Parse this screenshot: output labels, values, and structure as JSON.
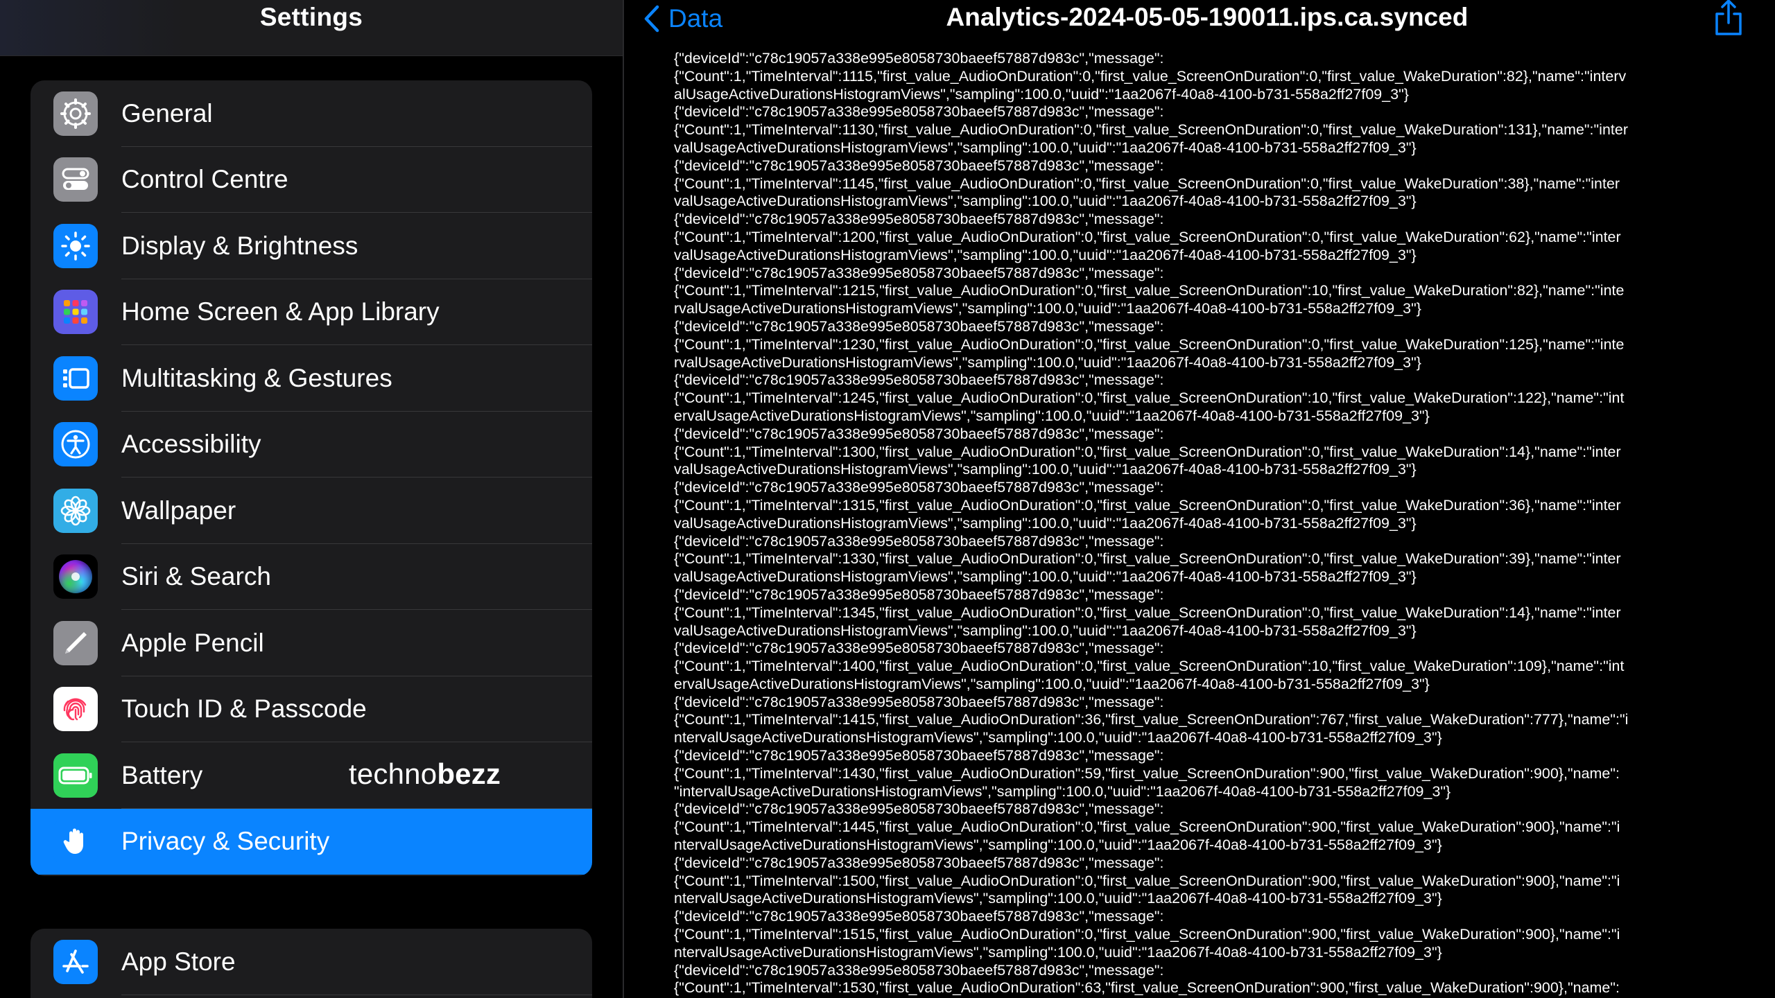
{
  "sidebar": {
    "title": "Settings",
    "items": [
      {
        "label": "General",
        "icon": "gear-icon",
        "color": "#8e8e93"
      },
      {
        "label": "Control Centre",
        "icon": "toggles-icon",
        "color": "#8e8e93"
      },
      {
        "label": "Display & Brightness",
        "icon": "sun-icon",
        "color": "#0a84ff"
      },
      {
        "label": "Home Screen & App Library",
        "icon": "app-grid-icon",
        "color": "#5e5ce6"
      },
      {
        "label": "Multitasking & Gestures",
        "icon": "multitasking-icon",
        "color": "#0a84ff"
      },
      {
        "label": "Accessibility",
        "icon": "accessibility-icon",
        "color": "#0a84ff"
      },
      {
        "label": "Wallpaper",
        "icon": "flower-icon",
        "color": "#32ade6"
      },
      {
        "label": "Siri & Search",
        "icon": "siri-icon",
        "color": "#000000"
      },
      {
        "label": "Apple Pencil",
        "icon": "pencil-icon",
        "color": "#8e8e93"
      },
      {
        "label": "Touch ID & Passcode",
        "icon": "fingerprint-icon",
        "color": "#ffffff"
      },
      {
        "label": "Battery",
        "icon": "battery-icon",
        "color": "#30d158"
      },
      {
        "label": "Privacy & Security",
        "icon": "hand-icon",
        "color": "#0a84ff",
        "selected": true
      }
    ],
    "items2": [
      {
        "label": "App Store",
        "icon": "app-store-icon",
        "color": "#0a84ff"
      }
    ]
  },
  "watermark": {
    "part1": "techno",
    "part2": "bezz"
  },
  "detail": {
    "back_label": "Data",
    "title": "Analytics-2024-05-05-190011.ips.ca.synced",
    "log_lines": [
      "{\"deviceId\":\"c78c19057a338e995e8058730baeef57887d983c\",\"message\":",
      "{\"Count\":1,\"TimeInterval\":1115,\"first_value_AudioOnDuration\":0,\"first_value_ScreenOnDuration\":0,\"first_value_WakeDuration\":82},\"name\":\"interv",
      "alUsageActiveDurationsHistogramViews\",\"sampling\":100.0,\"uuid\":\"1aa2067f-40a8-4100-b731-558a2ff27f09_3\"}",
      "{\"deviceId\":\"c78c19057a338e995e8058730baeef57887d983c\",\"message\":",
      "{\"Count\":1,\"TimeInterval\":1130,\"first_value_AudioOnDuration\":0,\"first_value_ScreenOnDuration\":0,\"first_value_WakeDuration\":131},\"name\":\"inter",
      "valUsageActiveDurationsHistogramViews\",\"sampling\":100.0,\"uuid\":\"1aa2067f-40a8-4100-b731-558a2ff27f09_3\"}",
      "{\"deviceId\":\"c78c19057a338e995e8058730baeef57887d983c\",\"message\":",
      "{\"Count\":1,\"TimeInterval\":1145,\"first_value_AudioOnDuration\":0,\"first_value_ScreenOnDuration\":0,\"first_value_WakeDuration\":38},\"name\":\"inter",
      "valUsageActiveDurationsHistogramViews\",\"sampling\":100.0,\"uuid\":\"1aa2067f-40a8-4100-b731-558a2ff27f09_3\"}",
      "{\"deviceId\":\"c78c19057a338e995e8058730baeef57887d983c\",\"message\":",
      "{\"Count\":1,\"TimeInterval\":1200,\"first_value_AudioOnDuration\":0,\"first_value_ScreenOnDuration\":0,\"first_value_WakeDuration\":62},\"name\":\"inter",
      "valUsageActiveDurationsHistogramViews\",\"sampling\":100.0,\"uuid\":\"1aa2067f-40a8-4100-b731-558a2ff27f09_3\"}",
      "{\"deviceId\":\"c78c19057a338e995e8058730baeef57887d983c\",\"message\":",
      "{\"Count\":1,\"TimeInterval\":1215,\"first_value_AudioOnDuration\":0,\"first_value_ScreenOnDuration\":10,\"first_value_WakeDuration\":82},\"name\":\"inte",
      "rvalUsageActiveDurationsHistogramViews\",\"sampling\":100.0,\"uuid\":\"1aa2067f-40a8-4100-b731-558a2ff27f09_3\"}",
      "{\"deviceId\":\"c78c19057a338e995e8058730baeef57887d983c\",\"message\":",
      "{\"Count\":1,\"TimeInterval\":1230,\"first_value_AudioOnDuration\":0,\"first_value_ScreenOnDuration\":0,\"first_value_WakeDuration\":125},\"name\":\"inte",
      "rvalUsageActiveDurationsHistogramViews\",\"sampling\":100.0,\"uuid\":\"1aa2067f-40a8-4100-b731-558a2ff27f09_3\"}",
      "{\"deviceId\":\"c78c19057a338e995e8058730baeef57887d983c\",\"message\":",
      "{\"Count\":1,\"TimeInterval\":1245,\"first_value_AudioOnDuration\":0,\"first_value_ScreenOnDuration\":10,\"first_value_WakeDuration\":122},\"name\":\"int",
      "ervalUsageActiveDurationsHistogramViews\",\"sampling\":100.0,\"uuid\":\"1aa2067f-40a8-4100-b731-558a2ff27f09_3\"}",
      "{\"deviceId\":\"c78c19057a338e995e8058730baeef57887d983c\",\"message\":",
      "{\"Count\":1,\"TimeInterval\":1300,\"first_value_AudioOnDuration\":0,\"first_value_ScreenOnDuration\":0,\"first_value_WakeDuration\":14},\"name\":\"inter",
      "valUsageActiveDurationsHistogramViews\",\"sampling\":100.0,\"uuid\":\"1aa2067f-40a8-4100-b731-558a2ff27f09_3\"}",
      "{\"deviceId\":\"c78c19057a338e995e8058730baeef57887d983c\",\"message\":",
      "{\"Count\":1,\"TimeInterval\":1315,\"first_value_AudioOnDuration\":0,\"first_value_ScreenOnDuration\":0,\"first_value_WakeDuration\":36},\"name\":\"inter",
      "valUsageActiveDurationsHistogramViews\",\"sampling\":100.0,\"uuid\":\"1aa2067f-40a8-4100-b731-558a2ff27f09_3\"}",
      "{\"deviceId\":\"c78c19057a338e995e8058730baeef57887d983c\",\"message\":",
      "{\"Count\":1,\"TimeInterval\":1330,\"first_value_AudioOnDuration\":0,\"first_value_ScreenOnDuration\":0,\"first_value_WakeDuration\":39},\"name\":\"inter",
      "valUsageActiveDurationsHistogramViews\",\"sampling\":100.0,\"uuid\":\"1aa2067f-40a8-4100-b731-558a2ff27f09_3\"}",
      "{\"deviceId\":\"c78c19057a338e995e8058730baeef57887d983c\",\"message\":",
      "{\"Count\":1,\"TimeInterval\":1345,\"first_value_AudioOnDuration\":0,\"first_value_ScreenOnDuration\":0,\"first_value_WakeDuration\":14},\"name\":\"inter",
      "valUsageActiveDurationsHistogramViews\",\"sampling\":100.0,\"uuid\":\"1aa2067f-40a8-4100-b731-558a2ff27f09_3\"}",
      "{\"deviceId\":\"c78c19057a338e995e8058730baeef57887d983c\",\"message\":",
      "{\"Count\":1,\"TimeInterval\":1400,\"first_value_AudioOnDuration\":0,\"first_value_ScreenOnDuration\":10,\"first_value_WakeDuration\":109},\"name\":\"int",
      "ervalUsageActiveDurationsHistogramViews\",\"sampling\":100.0,\"uuid\":\"1aa2067f-40a8-4100-b731-558a2ff27f09_3\"}",
      "{\"deviceId\":\"c78c19057a338e995e8058730baeef57887d983c\",\"message\":",
      "{\"Count\":1,\"TimeInterval\":1415,\"first_value_AudioOnDuration\":36,\"first_value_ScreenOnDuration\":767,\"first_value_WakeDuration\":777},\"name\":\"i",
      "ntervalUsageActiveDurationsHistogramViews\",\"sampling\":100.0,\"uuid\":\"1aa2067f-40a8-4100-b731-558a2ff27f09_3\"}",
      "{\"deviceId\":\"c78c19057a338e995e8058730baeef57887d983c\",\"message\":",
      "{\"Count\":1,\"TimeInterval\":1430,\"first_value_AudioOnDuration\":59,\"first_value_ScreenOnDuration\":900,\"first_value_WakeDuration\":900},\"name\":",
      "\"intervalUsageActiveDurationsHistogramViews\",\"sampling\":100.0,\"uuid\":\"1aa2067f-40a8-4100-b731-558a2ff27f09_3\"}",
      "{\"deviceId\":\"c78c19057a338e995e8058730baeef57887d983c\",\"message\":",
      "{\"Count\":1,\"TimeInterval\":1445,\"first_value_AudioOnDuration\":0,\"first_value_ScreenOnDuration\":900,\"first_value_WakeDuration\":900},\"name\":\"i",
      "ntervalUsageActiveDurationsHistogramViews\",\"sampling\":100.0,\"uuid\":\"1aa2067f-40a8-4100-b731-558a2ff27f09_3\"}",
      "{\"deviceId\":\"c78c19057a338e995e8058730baeef57887d983c\",\"message\":",
      "{\"Count\":1,\"TimeInterval\":1500,\"first_value_AudioOnDuration\":0,\"first_value_ScreenOnDuration\":900,\"first_value_WakeDuration\":900},\"name\":\"i",
      "ntervalUsageActiveDurationsHistogramViews\",\"sampling\":100.0,\"uuid\":\"1aa2067f-40a8-4100-b731-558a2ff27f09_3\"}",
      "{\"deviceId\":\"c78c19057a338e995e8058730baeef57887d983c\",\"message\":",
      "{\"Count\":1,\"TimeInterval\":1515,\"first_value_AudioOnDuration\":0,\"first_value_ScreenOnDuration\":900,\"first_value_WakeDuration\":900},\"name\":\"i",
      "ntervalUsageActiveDurationsHistogramViews\",\"sampling\":100.0,\"uuid\":\"1aa2067f-40a8-4100-b731-558a2ff27f09_3\"}",
      "{\"deviceId\":\"c78c19057a338e995e8058730baeef57887d983c\",\"message\":",
      "{\"Count\":1,\"TimeInterval\":1530,\"first_value_AudioOnDuration\":63,\"first_value_ScreenOnDuration\":900,\"first_value_WakeDuration\":900},\"name\":"
    ]
  }
}
